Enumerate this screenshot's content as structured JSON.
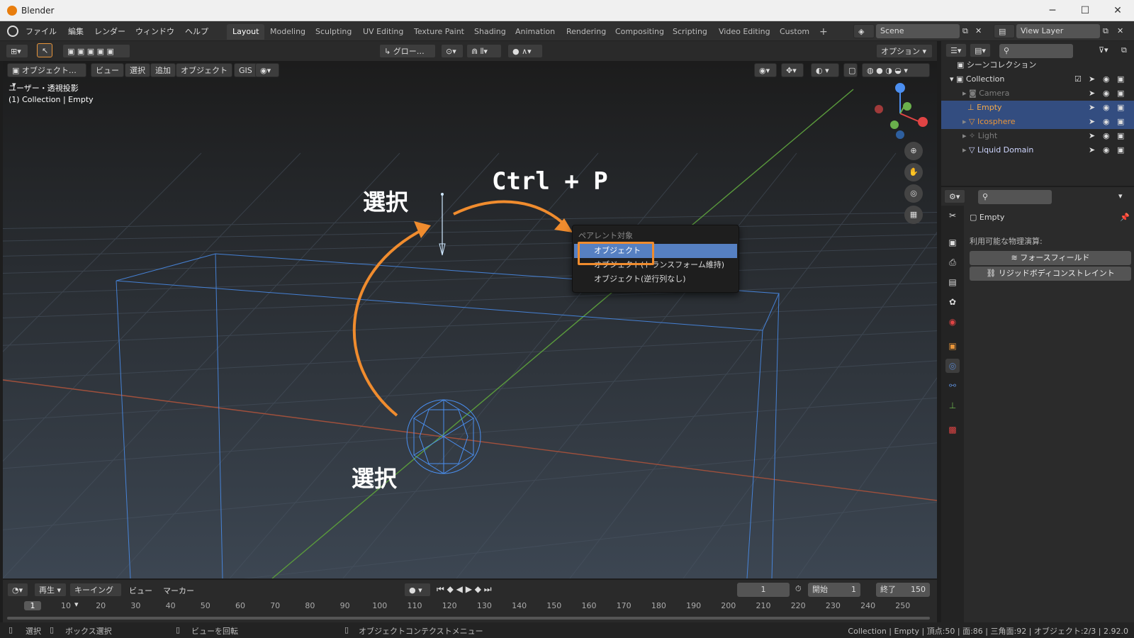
{
  "window": {
    "title": "Blender",
    "minimize_glyph": "─",
    "maximize_glyph": "☐",
    "close_glyph": "✕"
  },
  "menubar": {
    "menus": [
      "ファイル",
      "編集",
      "レンダー",
      "ウィンドウ",
      "ヘルプ"
    ],
    "workspaces": [
      "Layout",
      "Modeling",
      "Sculpting",
      "UV Editing",
      "Texture Paint",
      "Shading",
      "Animation",
      "Rendering",
      "Compositing",
      "Scripting",
      "Video Editing",
      "Custom"
    ],
    "active_workspace": "Layout",
    "add_glyph": "+",
    "scene": "Scene",
    "view_layer": "View Layer"
  },
  "toolheader": {
    "orientation": "グロー…",
    "options": "オプション"
  },
  "viewport_header": {
    "mode": "オブジェクト…",
    "menus": [
      "ビュー",
      "選択",
      "追加",
      "オブジェクト",
      "GIS"
    ]
  },
  "viewport": {
    "view_label": "ユーザー・透視投影",
    "context_label": "(1) Collection | Empty"
  },
  "annotations": {
    "select_top": "選択",
    "select_bottom": "選択",
    "shortcut": "Ctrl + P"
  },
  "context_menu": {
    "title": "ペアレント対象",
    "items": [
      "オブジェクト",
      "オブジェクト(トランスフォーム維持)",
      "オブジェクト(逆行列なし)"
    ],
    "highlighted": "オブジェクト"
  },
  "outliner": {
    "root": "シーンコレクション",
    "collection": "Collection",
    "items": [
      {
        "name": "Camera",
        "icon": "camera-icon",
        "color": "#7d7d7d",
        "selected": false
      },
      {
        "name": "Empty",
        "icon": "empty-axes-icon",
        "color": "#f2a94a",
        "selected": true
      },
      {
        "name": "Icosphere",
        "icon": "mesh-triangle-icon",
        "color": "#e8953a",
        "selected": true
      },
      {
        "name": "Light",
        "icon": "light-icon",
        "color": "#7d7d7d",
        "selected": false
      },
      {
        "name": "Liquid Domain",
        "icon": "mesh-triangle-icon",
        "color": "#cfd6ff",
        "selected": false
      }
    ]
  },
  "properties": {
    "object_name": "Empty",
    "physics_label": "利用可能な物理演算:",
    "buttons": [
      "フォースフィールド",
      "リジッドボディコンストレイント"
    ]
  },
  "timeline": {
    "menus": [
      "再生",
      "キーイング",
      "ビュー",
      "マーカー"
    ],
    "current_frame": "1",
    "start_label": "開始",
    "start": "1",
    "end_label": "終了",
    "end": "150",
    "frames": [
      "1",
      "10",
      "20",
      "30",
      "40",
      "50",
      "60",
      "70",
      "80",
      "90",
      "100",
      "110",
      "120",
      "130",
      "140",
      "150",
      "160",
      "170",
      "180",
      "190",
      "200",
      "210",
      "220",
      "230",
      "240",
      "250"
    ]
  },
  "statusbar": {
    "select": "選択",
    "box_select": "ボックス選択",
    "rotate_view": "ビューを回転",
    "context_menu": "オブジェクトコンテクストメニュー",
    "stats": "Collection | Empty | 頂点:50 | 面:86 | 三角面:92 | オブジェクト:2/3 | 2.92.0"
  },
  "colors": {
    "accent_orange": "#f08c2e",
    "selection_blue": "#5680c2",
    "wire_blue": "#4a8ff0"
  }
}
